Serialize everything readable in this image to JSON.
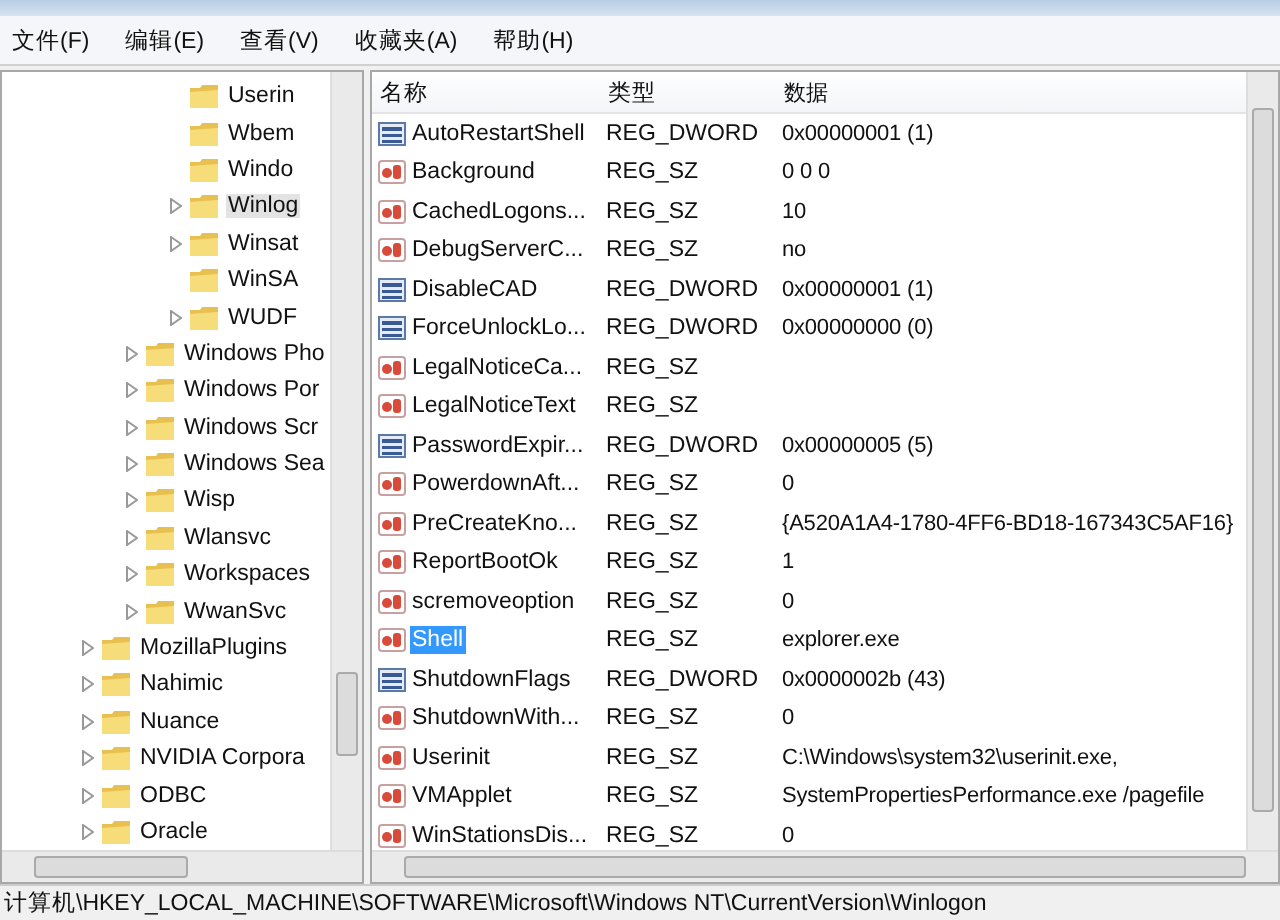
{
  "menu": [
    "文件(F)",
    "编辑(E)",
    "查看(V)",
    "收藏夹(A)",
    "帮助(H)"
  ],
  "tree": [
    {
      "children": [
        {
          "children": [
            {
              "label": "Userin",
              "expandable": false,
              "selected": false
            },
            {
              "label": "Wbem",
              "expandable": false,
              "selected": false
            },
            {
              "label": "Windo",
              "expandable": false,
              "selected": false
            },
            {
              "label": "Winlog",
              "expandable": true,
              "selected": true
            },
            {
              "label": "Winsat",
              "expandable": true,
              "selected": false
            },
            {
              "label": "WinSA",
              "expandable": false,
              "selected": false
            },
            {
              "label": "WUDF",
              "expandable": true,
              "selected": false
            }
          ]
        },
        {
          "label": "Windows Pho",
          "expandable": true,
          "selected": false
        },
        {
          "label": "Windows Por",
          "expandable": true,
          "selected": false
        },
        {
          "label": "Windows Scr",
          "expandable": true,
          "selected": false
        },
        {
          "label": "Windows Sea",
          "expandable": true,
          "selected": false
        },
        {
          "label": "Wisp",
          "expandable": true,
          "selected": false
        },
        {
          "label": "Wlansvc",
          "expandable": true,
          "selected": false
        },
        {
          "label": "Workspaces",
          "expandable": true,
          "selected": false
        },
        {
          "label": "WwanSvc",
          "expandable": true,
          "selected": false
        }
      ]
    },
    {
      "label": "MozillaPlugins",
      "expandable": true,
      "selected": false
    },
    {
      "label": "Nahimic",
      "expandable": true,
      "selected": false
    },
    {
      "label": "Nuance",
      "expandable": true,
      "selected": false
    },
    {
      "label": "NVIDIA Corpora",
      "expandable": true,
      "selected": false
    },
    {
      "label": "ODBC",
      "expandable": true,
      "selected": false
    },
    {
      "label": "Oracle",
      "expandable": true,
      "selected": false
    }
  ],
  "columns": [
    "名称",
    "类型",
    "数据"
  ],
  "values": [
    {
      "kind": "binary",
      "name": "AutoRestartShell",
      "type": "REG_DWORD",
      "data": "0x00000001 (1)",
      "selected": false
    },
    {
      "kind": "string",
      "name": "Background",
      "type": "REG_SZ",
      "data": "0 0 0",
      "selected": false
    },
    {
      "kind": "string",
      "name": "CachedLogons...",
      "type": "REG_SZ",
      "data": "10",
      "selected": false
    },
    {
      "kind": "string",
      "name": "DebugServerC...",
      "type": "REG_SZ",
      "data": "no",
      "selected": false
    },
    {
      "kind": "binary",
      "name": "DisableCAD",
      "type": "REG_DWORD",
      "data": "0x00000001 (1)",
      "selected": false
    },
    {
      "kind": "binary",
      "name": "ForceUnlockLo...",
      "type": "REG_DWORD",
      "data": "0x00000000 (0)",
      "selected": false
    },
    {
      "kind": "string",
      "name": "LegalNoticeCa...",
      "type": "REG_SZ",
      "selected": false
    },
    {
      "kind": "string",
      "name": "LegalNoticeText",
      "type": "REG_SZ",
      "selected": false
    },
    {
      "kind": "binary",
      "name": "PasswordExpir...",
      "type": "REG_DWORD",
      "data": "0x00000005 (5)",
      "selected": false
    },
    {
      "kind": "string",
      "name": "PowerdownAft...",
      "type": "REG_SZ",
      "data": "0",
      "selected": false
    },
    {
      "kind": "string",
      "name": "PreCreateKno...",
      "type": "REG_SZ",
      "data": "{A520A1A4-1780-4FF6-BD18-167343C5AF16}",
      "selected": false
    },
    {
      "kind": "string",
      "name": "ReportBootOk",
      "type": "REG_SZ",
      "data": "1",
      "selected": false
    },
    {
      "kind": "string",
      "name": "scremoveoption",
      "type": "REG_SZ",
      "data": "0",
      "selected": false
    },
    {
      "kind": "string",
      "name": "Shell",
      "type": "REG_SZ",
      "data": "explorer.exe",
      "selected": true
    },
    {
      "kind": "binary",
      "name": "ShutdownFlags",
      "type": "REG_DWORD",
      "data": "0x0000002b (43)",
      "selected": false
    },
    {
      "kind": "string",
      "name": "ShutdownWith...",
      "type": "REG_SZ",
      "data": "0",
      "selected": false
    },
    {
      "kind": "string",
      "name": "Userinit",
      "type": "REG_SZ",
      "data": "C:\\Windows\\system32\\userinit.exe,",
      "selected": false
    },
    {
      "kind": "string",
      "name": "VMApplet",
      "type": "REG_SZ",
      "data": "SystemPropertiesPerformance.exe /pagefile",
      "selected": false
    },
    {
      "kind": "string",
      "name": "WinStationsDis...",
      "type": "REG_SZ",
      "data": "0",
      "selected": false
    }
  ],
  "status_bar": "计算机\\HKEY_LOCAL_MACHINE\\SOFTWARE\\Microsoft\\Windows NT\\CurrentVersion\\Winlogon"
}
